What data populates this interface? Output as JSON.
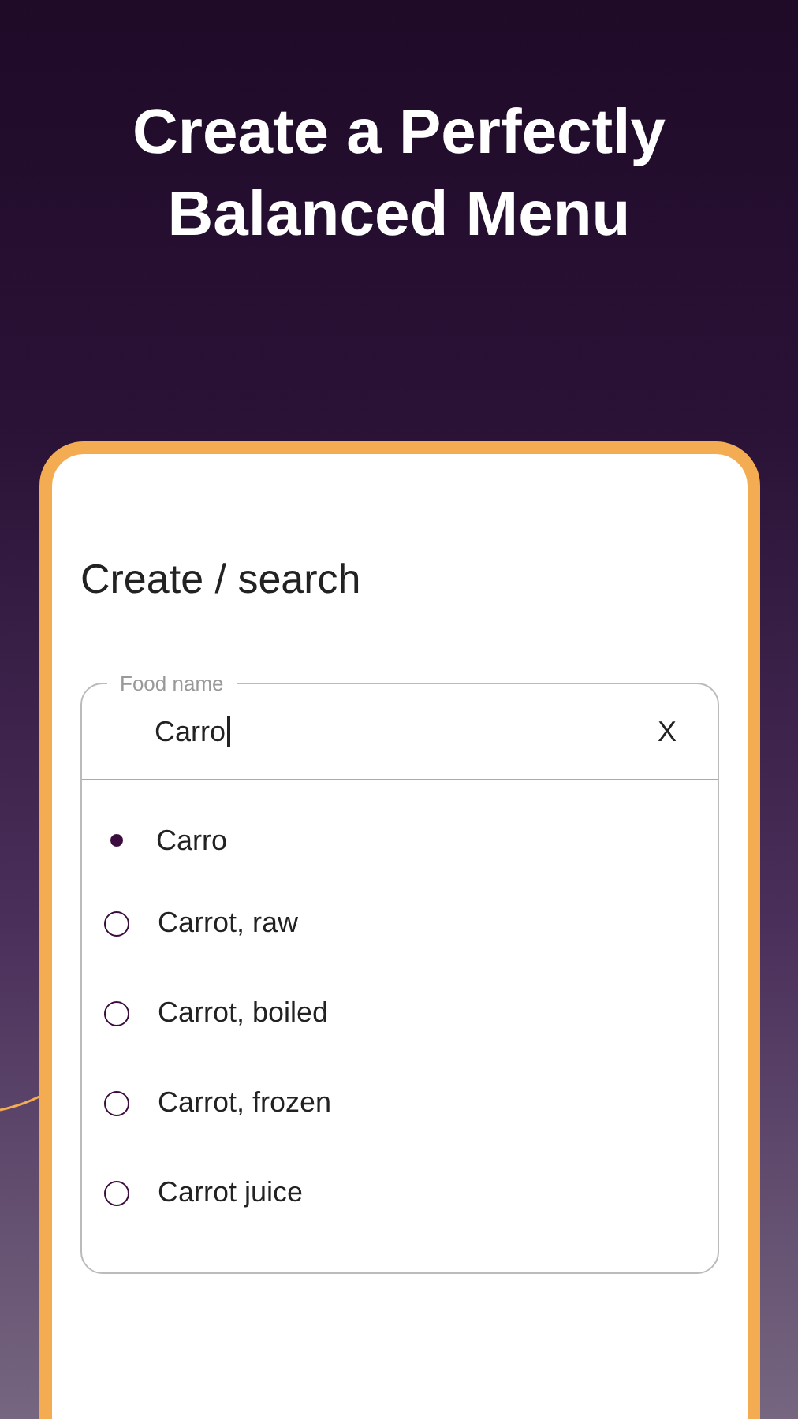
{
  "headline": "Create a Perfectly Balanced Menu",
  "card": {
    "title": "Create / search",
    "field": {
      "label": "Food name",
      "value": "Carro",
      "clear": "X"
    },
    "suggestions": [
      {
        "kind": "create",
        "label": "Carro"
      },
      {
        "kind": "option",
        "label": "Carrot, raw"
      },
      {
        "kind": "option",
        "label": "Carrot, boiled"
      },
      {
        "kind": "option",
        "label": "Carrot, frozen"
      },
      {
        "kind": "option",
        "label": "Carrot juice"
      }
    ]
  }
}
